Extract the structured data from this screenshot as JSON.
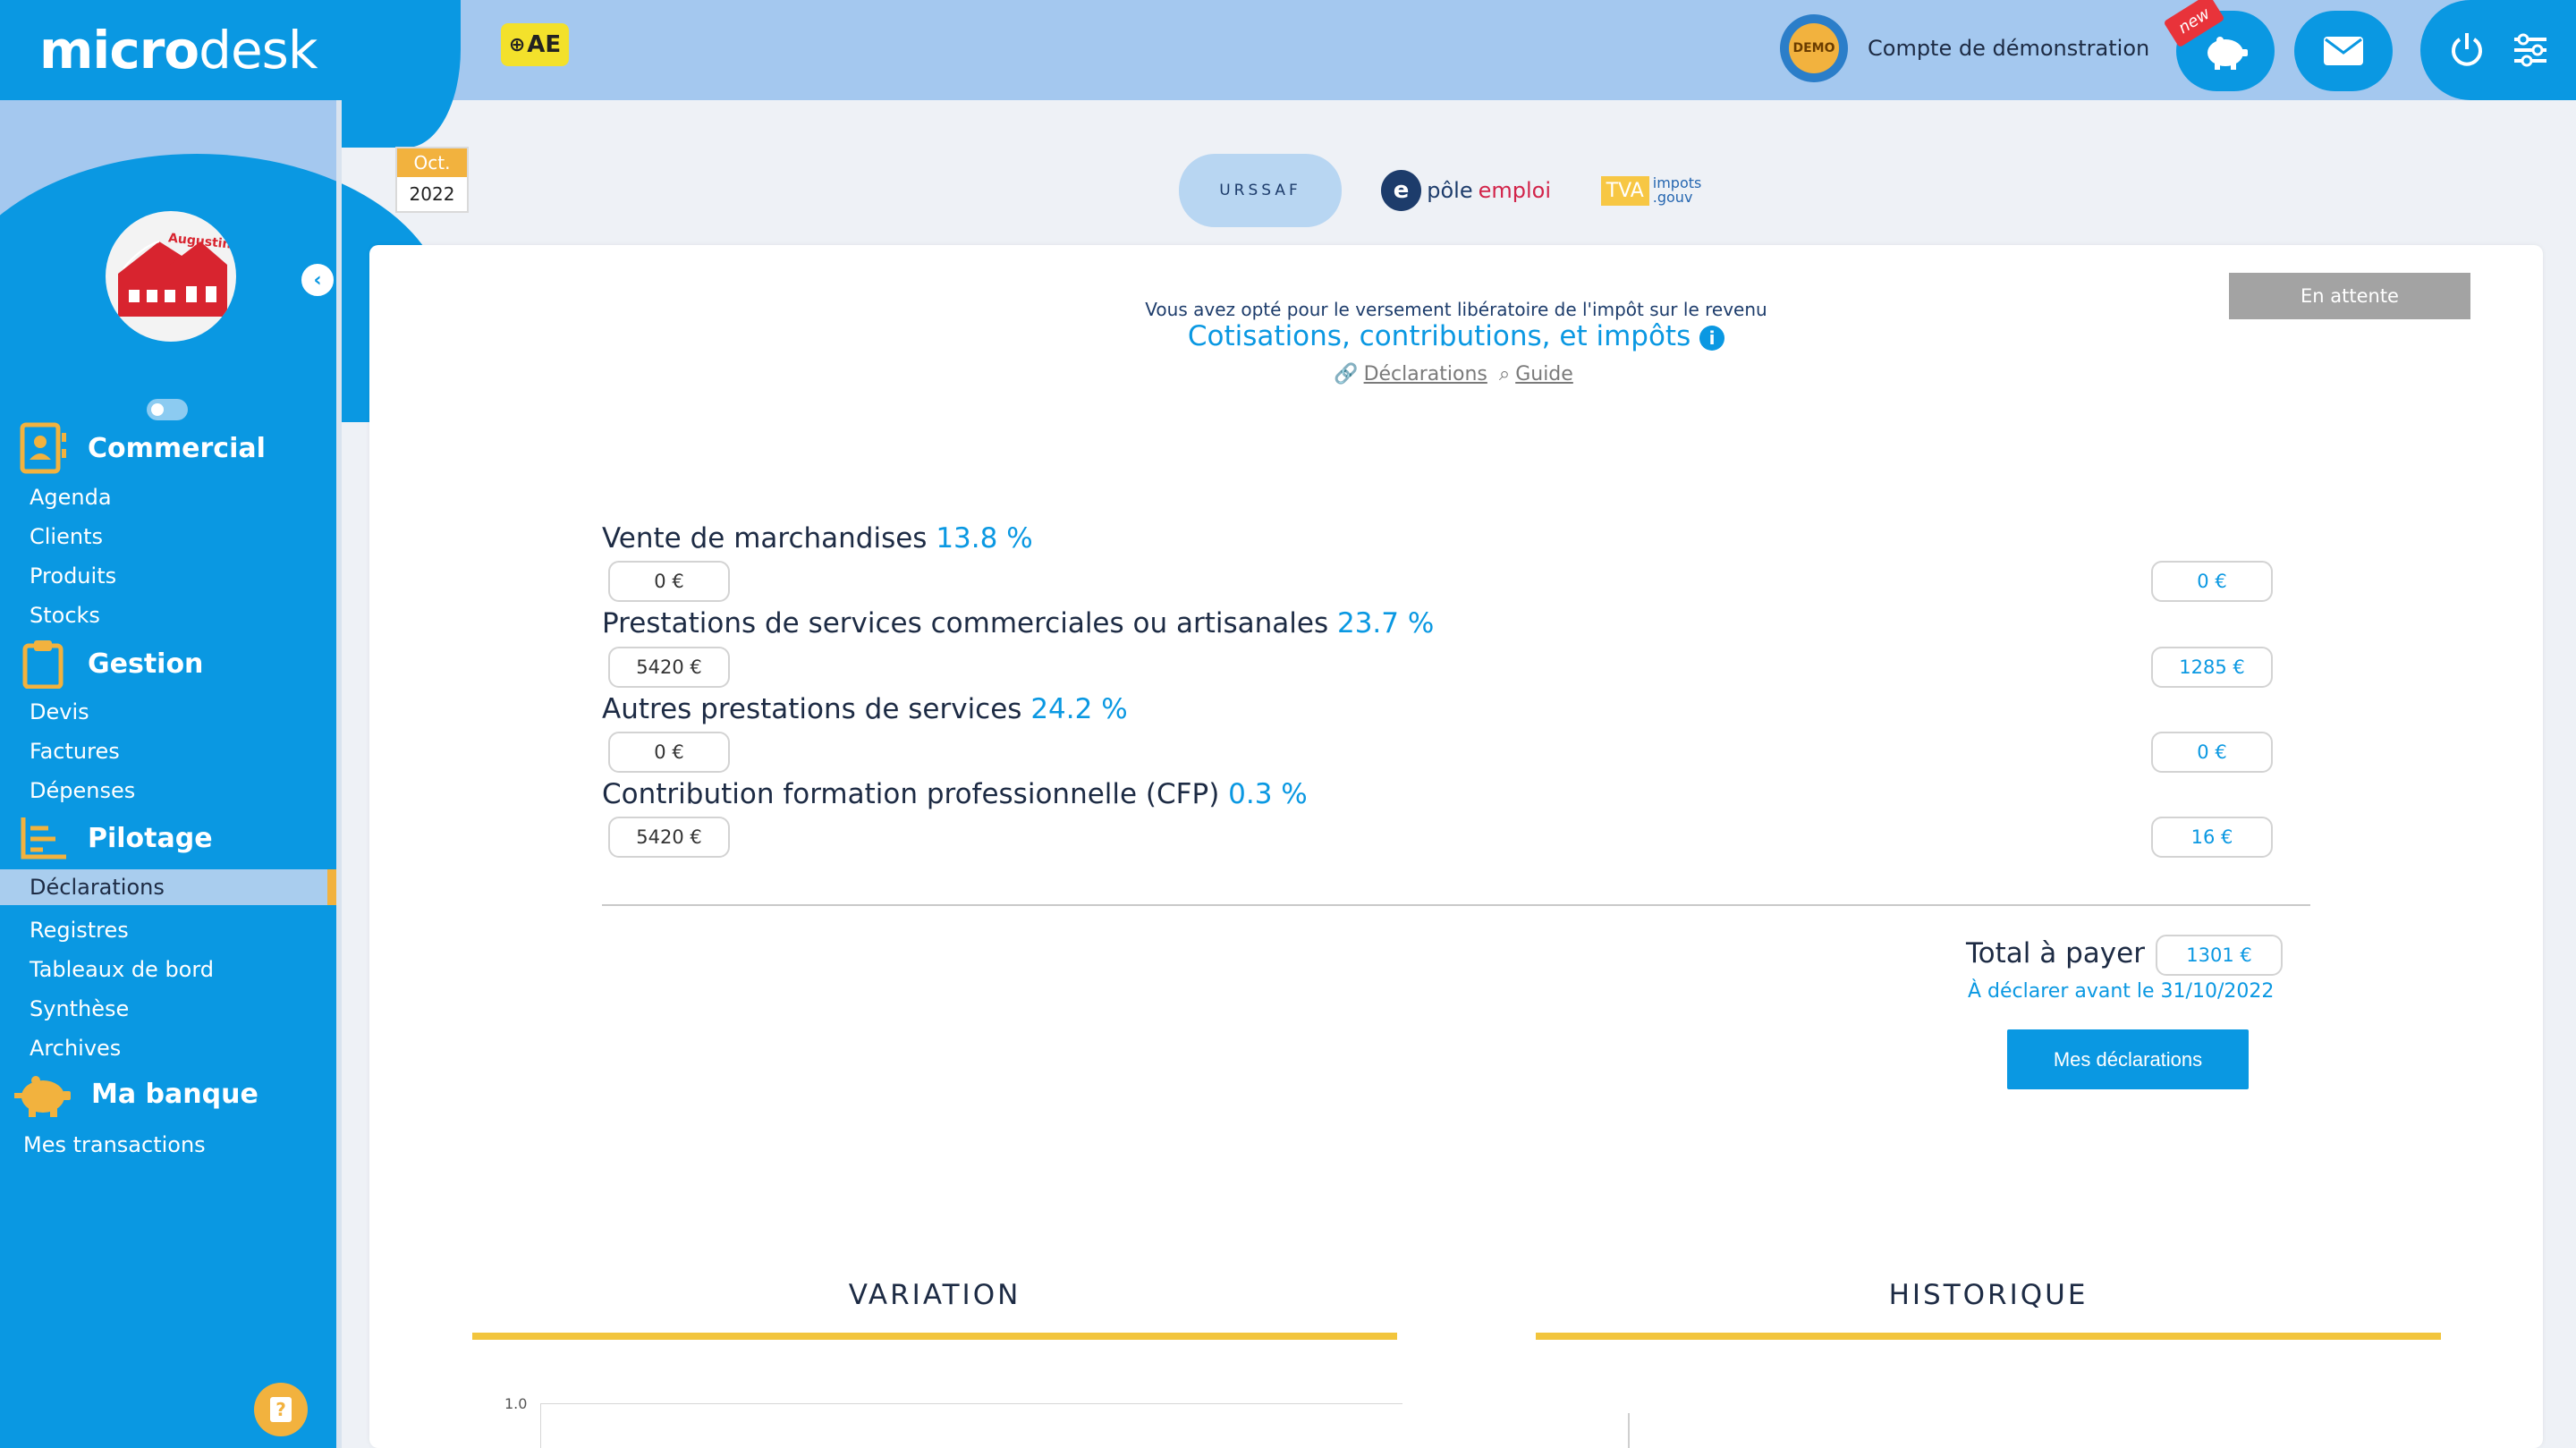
{
  "header": {
    "logo_bold": "micro",
    "logo_rest": "desk",
    "status_badge": "AE",
    "account_avatar_text": "DEMO",
    "account_name": "Compte de démonstration",
    "new_ribbon": "new"
  },
  "sidebar": {
    "sections": [
      {
        "label": "Commercial",
        "items": [
          "Agenda",
          "Clients",
          "Produits",
          "Stocks"
        ]
      },
      {
        "label": "Gestion",
        "items": [
          "Devis",
          "Factures",
          "Dépenses"
        ]
      },
      {
        "label": "Pilotage",
        "items": [
          "Déclarations",
          "Registres",
          "Tableaux de bord",
          "Synthèse",
          "Archives"
        ]
      },
      {
        "label": "Ma banque",
        "items": [
          "Mes transactions"
        ]
      }
    ],
    "active_item": "Déclarations",
    "company_logo_text": "Augustin"
  },
  "period": {
    "month": "Oct.",
    "year": "2022"
  },
  "org_tabs": {
    "urssaf": "URSSAF",
    "pole_e": "e",
    "pole_a": "pôle",
    "pole_b": "emploi",
    "tva": "TVA",
    "impots_a": "impots",
    "impots_b": ".gouv"
  },
  "declaration": {
    "status": "En attente",
    "opted_text": "Vous avez opté pour le versement libératoire de l'impôt sur le revenu",
    "title": "Cotisations, contributions, et impôts",
    "info_icon": "i",
    "links": {
      "declarations": "Déclarations",
      "guide": "Guide"
    },
    "rows": [
      {
        "label": "Vente de marchandises",
        "rate": "13.8 %",
        "base": "0 €",
        "amount": "0 €"
      },
      {
        "label": "Prestations de services commerciales ou artisanales",
        "rate": "23.7 %",
        "base": "5420 €",
        "amount": "1285 €"
      },
      {
        "label": "Autres prestations de services",
        "rate": "24.2 %",
        "base": "0 €",
        "amount": "0 €"
      },
      {
        "label": "Contribution formation professionnelle (CFP)",
        "rate": "0.3 %",
        "base": "5420 €",
        "amount": "16 €"
      }
    ],
    "total_label": "Total à payer",
    "total_value": "1301 €",
    "deadline": "À déclarer avant le 31/10/2022",
    "button": "Mes déclarations"
  },
  "sections": {
    "variation": "VARIATION",
    "historique": "HISTORIQUE",
    "variation_tick": "1.0"
  },
  "help_label": "?",
  "colors": {
    "primary": "#0a98e2",
    "header": "#a4c8ef",
    "accent": "#f2b23e",
    "gold_line": "#f2c53d"
  }
}
